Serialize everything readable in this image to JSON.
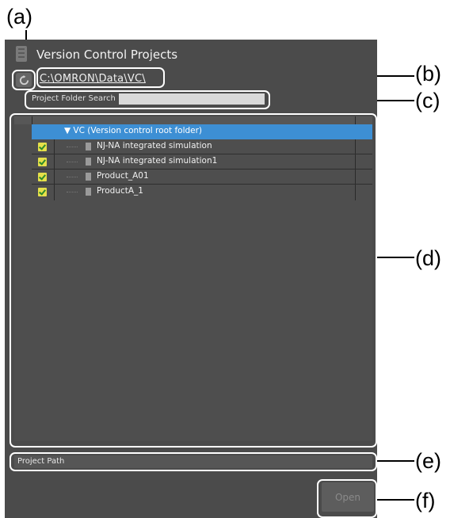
{
  "window": {
    "title": "Version Control Projects",
    "icon": "list-icon"
  },
  "toolbar": {
    "refresh_icon": "refresh-icon",
    "path": "C:\\OMRON\\Data\\VC\\"
  },
  "search": {
    "label": "Project Folder Search",
    "value": ""
  },
  "tree": {
    "root": "VC (Version control root folder)",
    "items": [
      {
        "label": "NJ-NA integrated simulation",
        "status_icon": "checked-out-icon"
      },
      {
        "label": "NJ-NA integrated simulation1",
        "status_icon": "checked-out-icon"
      },
      {
        "label": "Product_A01",
        "status_icon": "checked-out-icon"
      },
      {
        "label": "ProductA_1",
        "status_icon": "checked-out-icon"
      }
    ]
  },
  "project_path": {
    "label": "Project Path"
  },
  "open_button": {
    "label": "Open"
  },
  "callouts": [
    "(a)",
    "(b)",
    "(c)",
    "(d)",
    "(e)",
    "(f)"
  ]
}
